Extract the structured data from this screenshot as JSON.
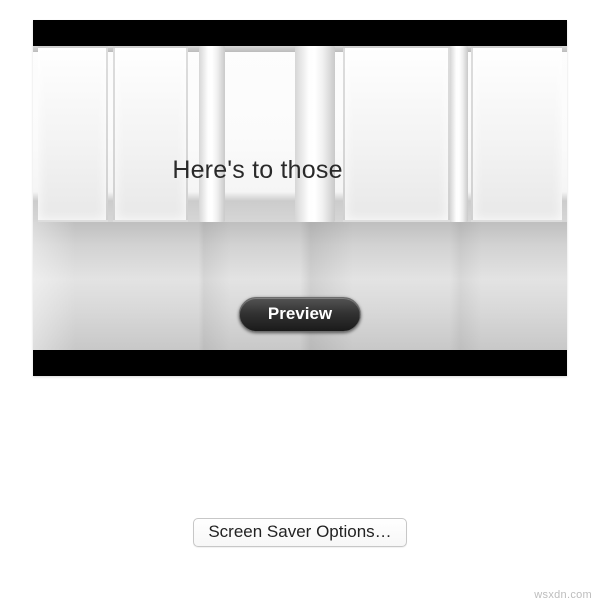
{
  "screensaver": {
    "caption_text": "Here's to those",
    "preview_button_label": "Preview"
  },
  "options_button_label": "Screen Saver Options…",
  "watermark": "wsxdn.com"
}
